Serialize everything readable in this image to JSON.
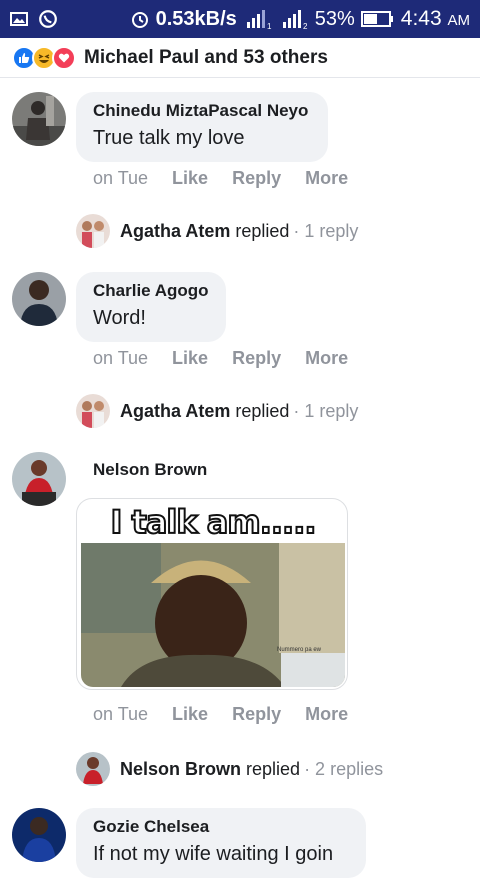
{
  "status_bar": {
    "speed": "0.53kB/s",
    "battery": "53%",
    "time": "4:43",
    "ampm": "AM",
    "icons": [
      "image-icon",
      "whatsapp-icon",
      "alarm-icon",
      "signal-h-plus-1-icon",
      "signal-g-2-icon",
      "battery-icon"
    ],
    "background": "#1e2a78"
  },
  "reactions": {
    "icons": [
      "like-reaction-icon",
      "haha-reaction-icon",
      "love-reaction-icon"
    ],
    "text": "Michael Paul and 53 others"
  },
  "comments": [
    {
      "author": "Chinedu MiztaPascal Neyo",
      "text": "True talk my love",
      "actions": {
        "time": "on Tue",
        "like": "Like",
        "reply": "Reply",
        "more": "More"
      },
      "reply": {
        "name": "Agatha Atem",
        "verb": "replied",
        "count": "· 1 reply"
      }
    },
    {
      "author": "Charlie Agogo",
      "text": "Word!",
      "actions": {
        "time": "on Tue",
        "like": "Like",
        "reply": "Reply",
        "more": "More"
      },
      "reply": {
        "name": "Agatha Atem",
        "verb": "replied",
        "count": "· 1 reply"
      }
    },
    {
      "author": "Nelson Brown",
      "image_caption": "I talk am.....",
      "image_subtext": "Nummero pa ew",
      "actions": {
        "time": "on Tue",
        "like": "Like",
        "reply": "Reply",
        "more": "More"
      },
      "reply": {
        "name": "Nelson Brown",
        "verb": "replied",
        "count": "· 2 replies"
      }
    },
    {
      "author": "Gozie Chelsea",
      "text": "If not my wife waiting I goin"
    }
  ]
}
